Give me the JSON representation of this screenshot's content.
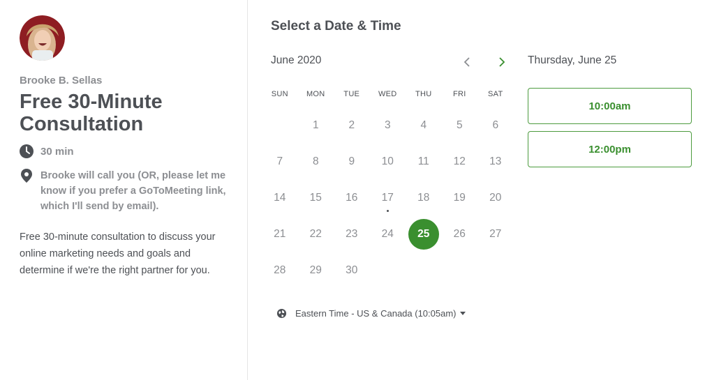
{
  "host": {
    "name": "Brooke B. Sellas"
  },
  "event": {
    "title": "Free 30-Minute Consultation",
    "duration": "30 min",
    "location": "Brooke will call you (OR, please let me know if you prefer a GoToMeeting link, which I'll send by email).",
    "description": "Free 30-minute consultation to discuss your online marketing needs and goals and determine if we're the right partner for you."
  },
  "scheduler": {
    "title": "Select a Date & Time",
    "month_label": "June 2020",
    "weekdays": [
      "SUN",
      "MON",
      "TUE",
      "WED",
      "THU",
      "FRI",
      "SAT"
    ],
    "days": [
      {
        "label": "",
        "state": "empty"
      },
      {
        "label": "1",
        "state": "unavailable"
      },
      {
        "label": "2",
        "state": "unavailable"
      },
      {
        "label": "3",
        "state": "unavailable"
      },
      {
        "label": "4",
        "state": "unavailable"
      },
      {
        "label": "5",
        "state": "unavailable"
      },
      {
        "label": "6",
        "state": "unavailable"
      },
      {
        "label": "7",
        "state": "unavailable"
      },
      {
        "label": "8",
        "state": "unavailable"
      },
      {
        "label": "9",
        "state": "unavailable"
      },
      {
        "label": "10",
        "state": "unavailable"
      },
      {
        "label": "11",
        "state": "unavailable"
      },
      {
        "label": "12",
        "state": "unavailable"
      },
      {
        "label": "13",
        "state": "unavailable"
      },
      {
        "label": "14",
        "state": "unavailable"
      },
      {
        "label": "15",
        "state": "unavailable"
      },
      {
        "label": "16",
        "state": "unavailable"
      },
      {
        "label": "17",
        "state": "today"
      },
      {
        "label": "18",
        "state": "unavailable"
      },
      {
        "label": "19",
        "state": "unavailable"
      },
      {
        "label": "20",
        "state": "unavailable"
      },
      {
        "label": "21",
        "state": "unavailable"
      },
      {
        "label": "22",
        "state": "unavailable"
      },
      {
        "label": "23",
        "state": "unavailable"
      },
      {
        "label": "24",
        "state": "unavailable"
      },
      {
        "label": "25",
        "state": "selected"
      },
      {
        "label": "26",
        "state": "unavailable"
      },
      {
        "label": "27",
        "state": "unavailable"
      },
      {
        "label": "28",
        "state": "unavailable"
      },
      {
        "label": "29",
        "state": "unavailable"
      },
      {
        "label": "30",
        "state": "available"
      }
    ],
    "timezone": "Eastern Time - US & Canada (10:05am)",
    "selected_date": "Thursday, June 25",
    "time_slots": [
      "10:00am",
      "12:00pm"
    ]
  },
  "colors": {
    "accent": "#3a8f2f",
    "accent_light": "#ebf6e8",
    "text": "#4d5055",
    "muted": "#8c8e92"
  },
  "icons": {
    "duration": "clock-icon",
    "location": "location-pin-icon",
    "timezone": "globe-icon",
    "prev": "chevron-left-icon",
    "next": "chevron-right-icon"
  }
}
